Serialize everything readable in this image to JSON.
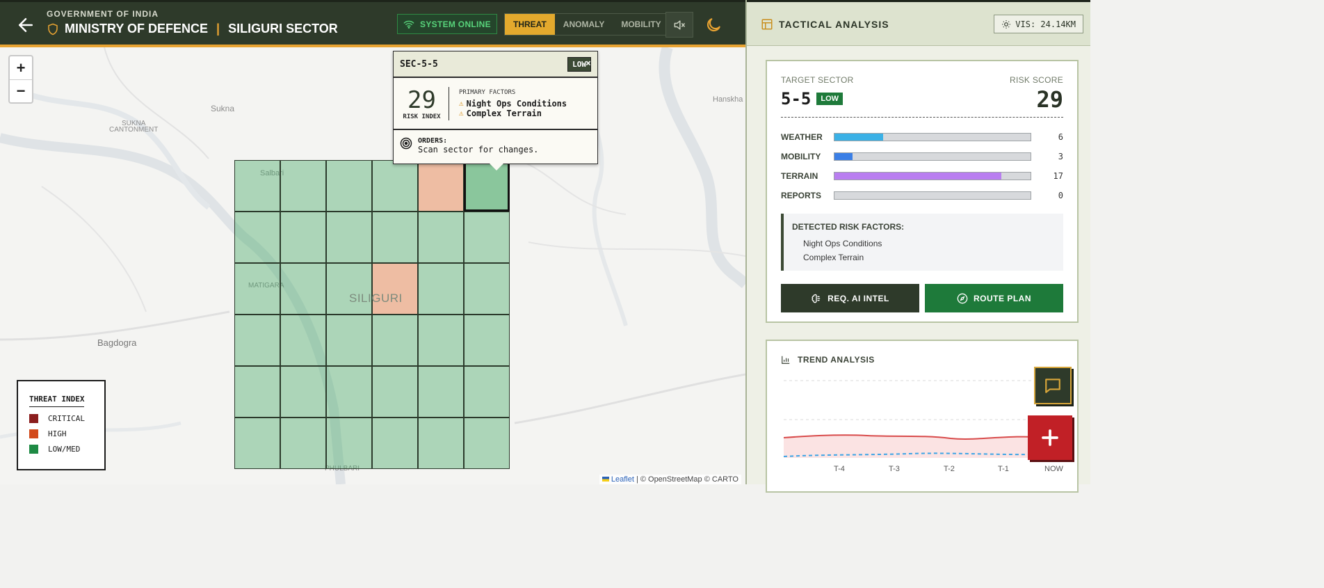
{
  "header": {
    "gov_label": "GOVERNMENT OF INDIA",
    "title_main": "MINISTRY OF DEFENCE",
    "title_sep": "|",
    "title_sector": "SILIGURI SECTOR",
    "status": "SYSTEM ONLINE",
    "modes": [
      "THREAT",
      "ANOMALY",
      "MOBILITY"
    ],
    "active_mode": "THREAT"
  },
  "map": {
    "places": {
      "sukna": "Sukna",
      "sukna_cantonment_1": "SUKNA",
      "sukna_cantonment_2": "CANTONMENT",
      "salbari": "Salbari",
      "matigara": "MATIGARA",
      "siliguri": "SILIGURI",
      "bagdogra": "Bagdogra",
      "hanskhali": "Hanskha",
      "phulbari": "PHULBARI"
    },
    "zoom_in": "+",
    "zoom_out": "−",
    "legend": {
      "title": "THREAT INDEX",
      "items": [
        {
          "label": "CRITICAL",
          "color": "#8b1e1e"
        },
        {
          "label": "HIGH",
          "color": "#d2491a"
        },
        {
          "label": "LOW/MED",
          "color": "#1e8a44"
        }
      ]
    },
    "attribution": {
      "leaflet": "Leaflet",
      "rest": "| © OpenStreetMap © CARTO"
    }
  },
  "popup": {
    "sector_id": "SEC-5-5",
    "badge": "LOW",
    "close": "×",
    "risk_index": "29",
    "risk_label": "RISK INDEX",
    "factors_title": "PRIMARY FACTORS",
    "factors": [
      "Night Ops Conditions",
      "Complex Terrain"
    ],
    "orders_title": "ORDERS:",
    "orders_text": "Scan sector for changes."
  },
  "panel": {
    "title": "TACTICAL ANALYSIS",
    "vis": "VIS: 24.14KM",
    "target_sector_label": "TARGET SECTOR",
    "target_sector": "5-5",
    "sector_badge": "LOW",
    "risk_score_label": "RISK SCORE",
    "risk_score": "29",
    "bars": [
      {
        "label": "WEATHER",
        "value": "6",
        "fraction": 0.25,
        "color": "#3bb1e6"
      },
      {
        "label": "MOBILITY",
        "value": "3",
        "fraction": 0.095,
        "color": "#3b7fe6"
      },
      {
        "label": "TERRAIN",
        "value": "17",
        "fraction": 0.85,
        "color": "#b97ef0"
      },
      {
        "label": "REPORTS",
        "value": "0",
        "fraction": 0.0,
        "color": "#888888"
      }
    ],
    "risk_factors_title": "DETECTED RISK FACTORS:",
    "risk_factors": [
      "Night Ops Conditions",
      "Complex Terrain"
    ],
    "btn_intel": "REQ. AI INTEL",
    "btn_route": "ROUTE PLAN",
    "trend_title": "TREND ANALYSIS",
    "trend_labels": [
      "T-4",
      "T-3",
      "T-2",
      "T-1",
      "NOW"
    ]
  },
  "grid": {
    "cols": 6,
    "rows": 6,
    "high_cells": [
      [
        0,
        4
      ],
      [
        2,
        3
      ]
    ],
    "selected_cell": [
      0,
      5
    ]
  }
}
